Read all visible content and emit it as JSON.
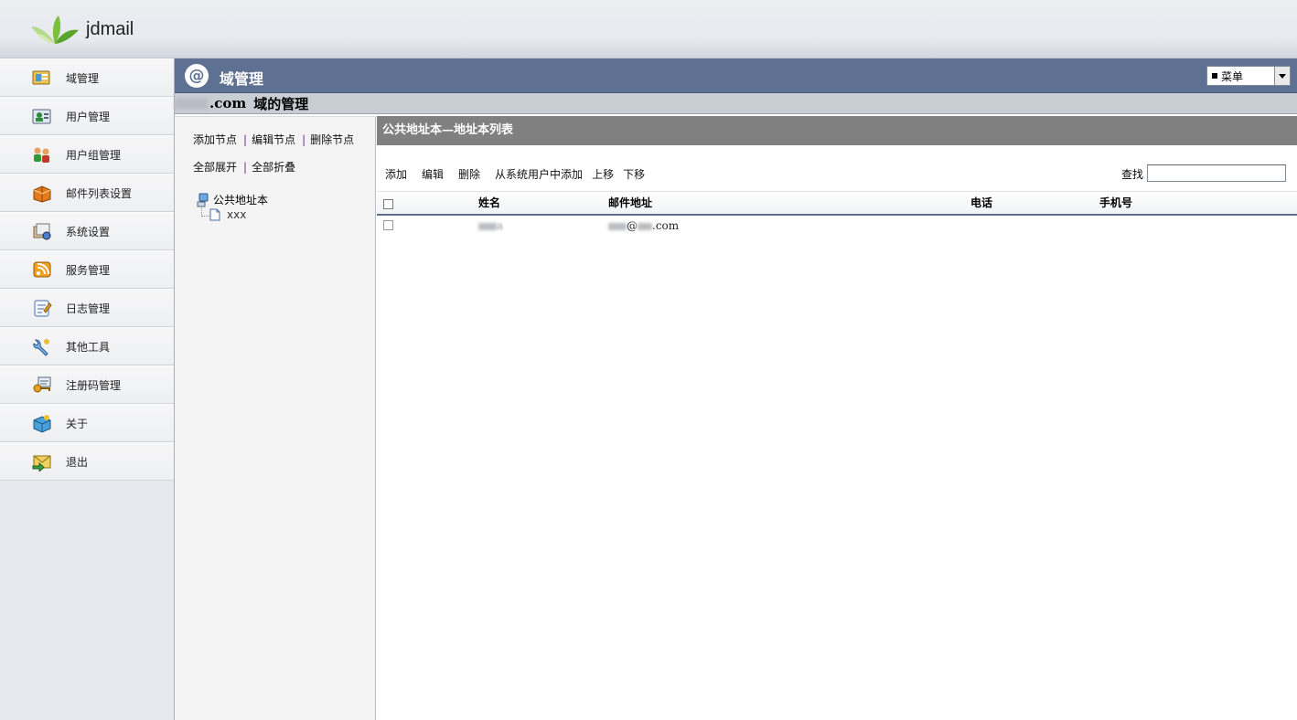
{
  "app": {
    "logo_text": "jdmail",
    "brand_color": "#5e7193"
  },
  "sidebar": {
    "items": [
      {
        "label": "域管理",
        "icon": "domain-icon"
      },
      {
        "label": "用户管理",
        "icon": "user-icon"
      },
      {
        "label": "用户组管理",
        "icon": "user-group-icon"
      },
      {
        "label": "邮件列表设置",
        "icon": "mail-list-icon"
      },
      {
        "label": "系统设置",
        "icon": "system-settings-icon"
      },
      {
        "label": "服务管理",
        "icon": "service-icon"
      },
      {
        "label": "日志管理",
        "icon": "log-icon"
      },
      {
        "label": "其他工具",
        "icon": "tools-icon"
      },
      {
        "label": "注册码管理",
        "icon": "license-key-icon"
      },
      {
        "label": "关于",
        "icon": "about-icon"
      },
      {
        "label": "退出",
        "icon": "exit-icon"
      }
    ]
  },
  "titlebar": {
    "at_symbol": "@",
    "title": "域管理",
    "menu_select_value": "菜单"
  },
  "subtitle": {
    "domain_suffix": ".com",
    "text": "域的管理"
  },
  "tree": {
    "add_node": "添加节点",
    "edit_node": "编辑节点",
    "delete_node": "删除节点",
    "expand_all": "全部展开",
    "collapse_all": "全部折叠",
    "separator": "|",
    "root_label": "公共地址本",
    "child_label": "xxx"
  },
  "content": {
    "header": "公共地址本—地址本列表",
    "actions": {
      "add": "添加",
      "edit": "编辑",
      "delete": "删除",
      "add_from_system": "从系统用户中添加",
      "move_up": "上移",
      "move_down": "下移"
    },
    "search_label": "查找",
    "columns": {
      "name": "姓名",
      "email": "邮件地址",
      "phone": "电话",
      "mobile": "手机号"
    },
    "rows": [
      {
        "name_suffix": "a",
        "email_at": "@",
        "email_suffix": ".com",
        "phone": "",
        "mobile": ""
      }
    ]
  }
}
